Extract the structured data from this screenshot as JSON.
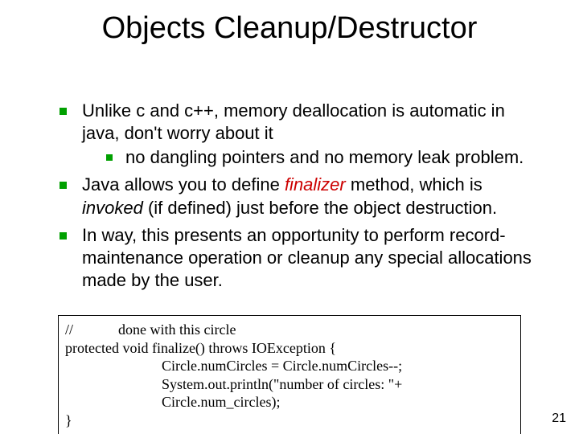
{
  "title": "Objects Cleanup/Destructor",
  "bullets": {
    "b1_pre": "Unlike c and c++, memory deallocation is automatic in java, don't worry about it",
    "b1_sub": "no dangling pointers and no memory leak problem.",
    "b2_pre": "Java allows you to define ",
    "b2_finalizer": "finalizer",
    "b2_mid": " method, which is ",
    "b2_invoked": "invoked",
    "b2_post": " (if defined) just before the object destruction.",
    "b3": "In way, this presents an opportunity to perform record-maintenance operation or cleanup any special allocations made by the user."
  },
  "code": {
    "l1a": "//",
    "l1b": "done with this circle",
    "l2": "protected void finalize() throws IOException {",
    "l3": "Circle.numCircles = Circle.numCircles--;",
    "l4": "System.out.println(\"number of circles: \"+ Circle.num_circles);",
    "l5": "}"
  },
  "page_number": "21"
}
